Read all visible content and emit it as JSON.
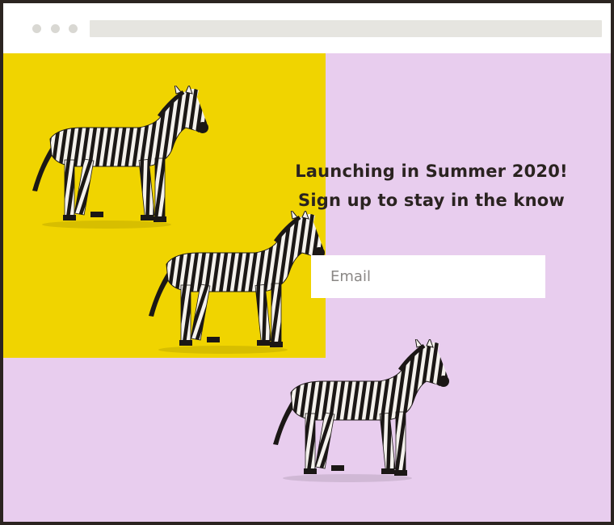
{
  "browser": {
    "dots": 3
  },
  "hero": {
    "headline_line1": "Launching in Summer 2020!",
    "headline_line2": "Sign up to stay in the know"
  },
  "signup": {
    "email_placeholder": "Email",
    "email_value": ""
  },
  "image": {
    "subject": "zebra-figurines",
    "count": 3
  },
  "colors": {
    "frame": "#2b2420",
    "yellow_block": "#f0d400",
    "lilac_background": "#e8cdee",
    "text": "#2a2320",
    "input_bg": "#ffffff"
  }
}
